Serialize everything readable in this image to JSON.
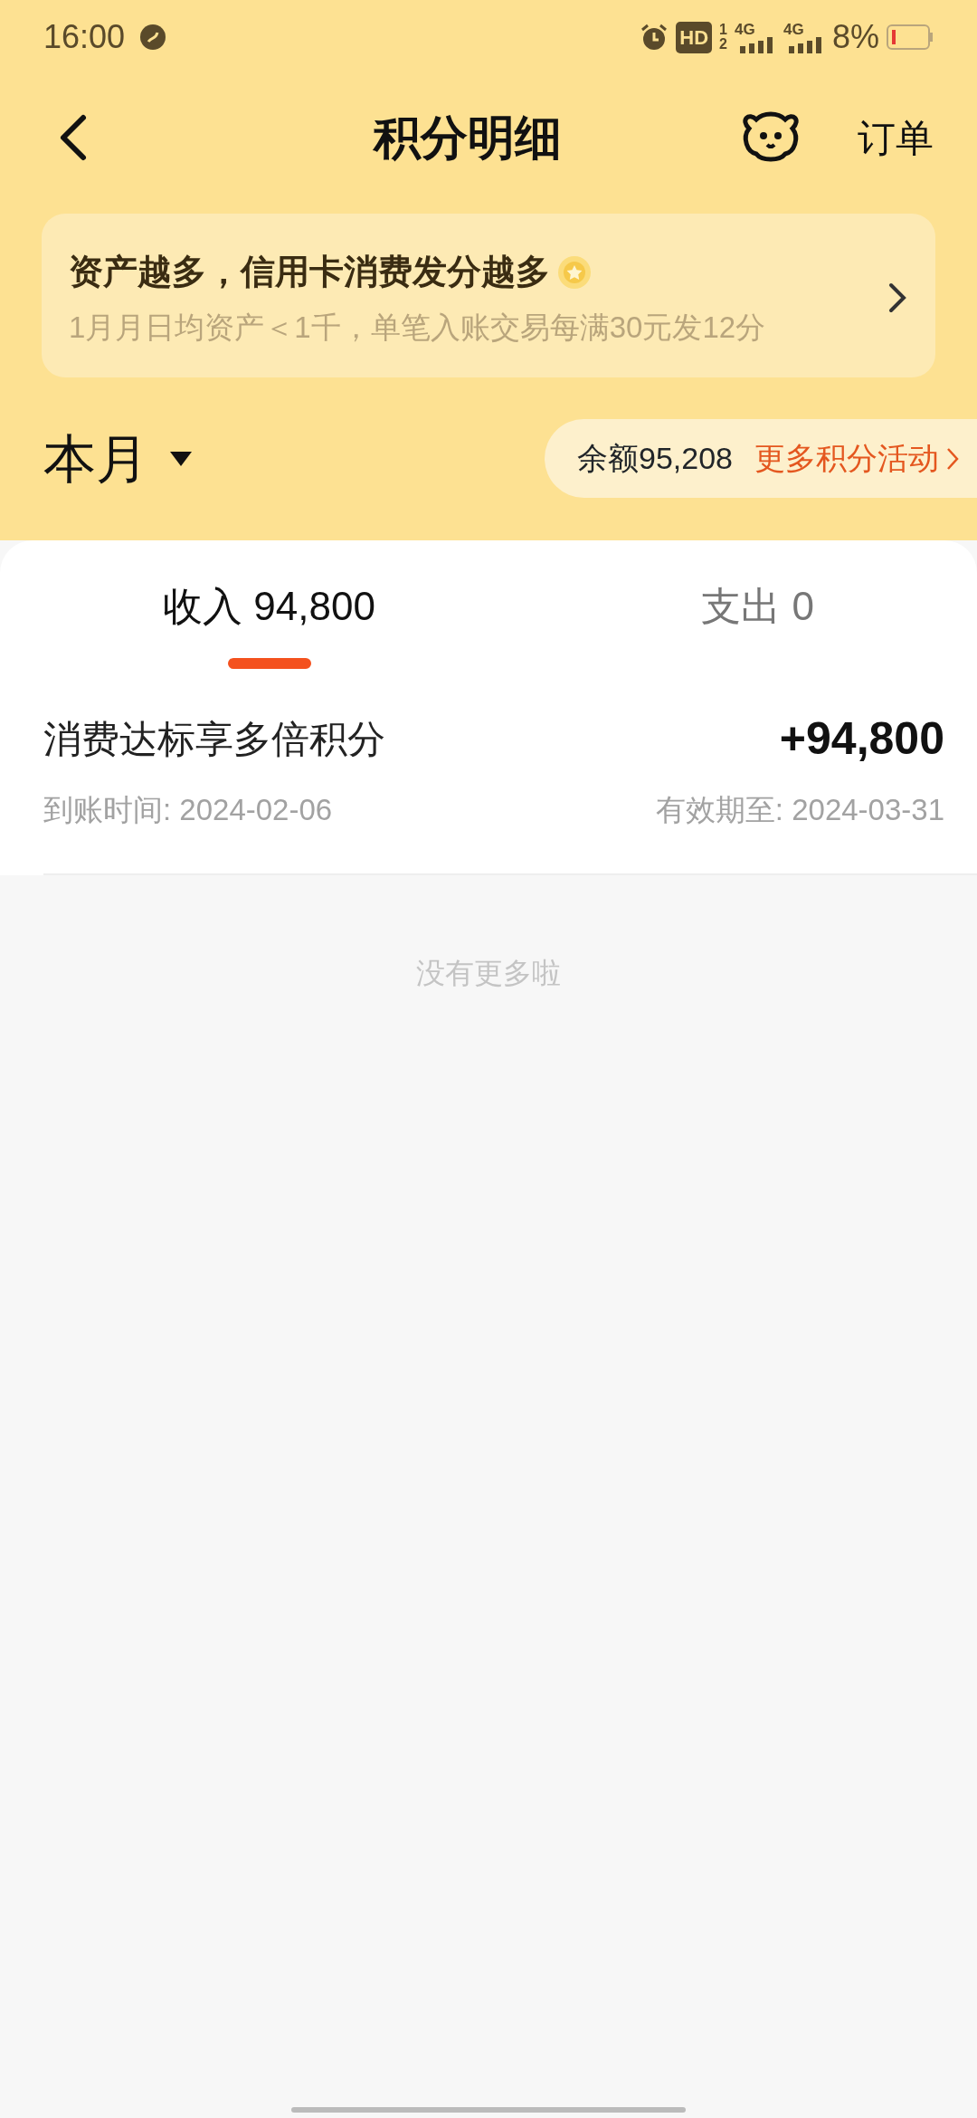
{
  "status_bar": {
    "time": "16:00",
    "hd_label": "HD",
    "sim_labels": [
      "1",
      "2"
    ],
    "network_labels": [
      "4G",
      "4G"
    ],
    "battery": "8%"
  },
  "header": {
    "title": "积分明细",
    "action": "订单"
  },
  "banner": {
    "title": "资产越多，信用卡消费发分越多",
    "subtitle": "1月月日均资产＜1千，单笔入账交易每满30元发12分"
  },
  "period": {
    "label": "本月"
  },
  "balance": {
    "text": "余额95,208",
    "link": "更多积分活动"
  },
  "tabs": [
    {
      "label": "收入 94,800",
      "selected": true
    },
    {
      "label": "支出 0",
      "selected": false
    }
  ],
  "records": [
    {
      "title": "消费达标享多倍积分",
      "amount": "+94,800",
      "arrival": "到账时间: 2024-02-06",
      "expiry": "有效期至: 2024-03-31"
    }
  ],
  "footer": "没有更多啦"
}
